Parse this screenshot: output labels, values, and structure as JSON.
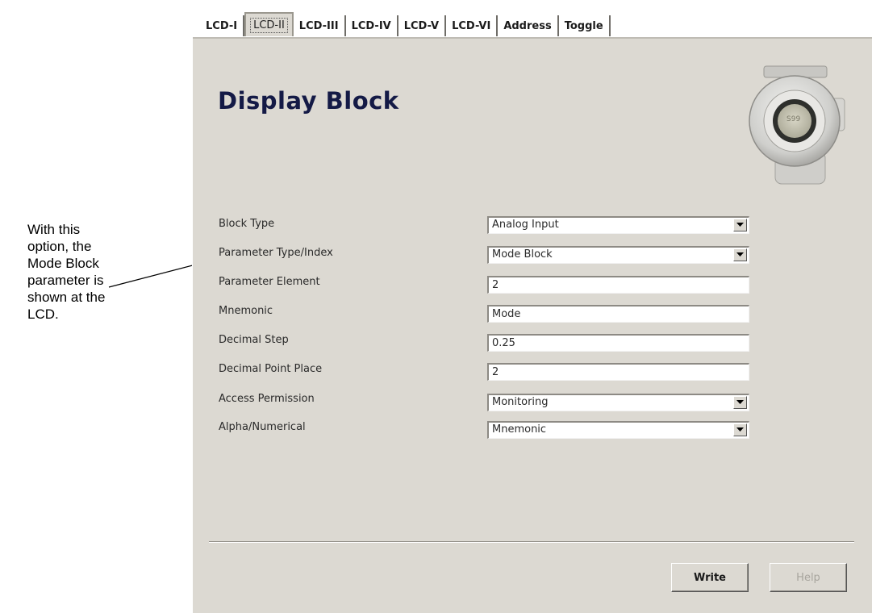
{
  "annotation": {
    "lines": [
      "With this",
      "option, the",
      "Mode Block",
      "parameter is",
      "shown at the",
      "LCD."
    ]
  },
  "tabs": [
    "LCD-I",
    "LCD-II",
    "LCD-III",
    "LCD-IV",
    "LCD-V",
    "LCD-VI",
    "Address",
    "Toggle"
  ],
  "active_tab": "LCD-II",
  "panel": {
    "title": "Display Block",
    "device_label": "S99"
  },
  "form": {
    "block_type": {
      "label": "Block Type",
      "value": "Analog Input"
    },
    "parameter_type_index": {
      "label": "Parameter Type/Index",
      "value": "Mode Block"
    },
    "parameter_element": {
      "label": "Parameter Element",
      "value": "2"
    },
    "mnemonic": {
      "label": "Mnemonic",
      "value": "Mode"
    },
    "decimal_step": {
      "label": "Decimal Step",
      "value": "0.25"
    },
    "decimal_point_place": {
      "label": "Decimal Point Place",
      "value": "2"
    },
    "access_permission": {
      "label": "Access Permission",
      "value": "Monitoring"
    },
    "alpha_numerical": {
      "label": "Alpha/Numerical",
      "value": "Mnemonic"
    }
  },
  "buttons": {
    "write": "Write",
    "help": "Help"
  },
  "colors": {
    "panel_bg": "#dcd9d2",
    "title": "#141a46"
  }
}
